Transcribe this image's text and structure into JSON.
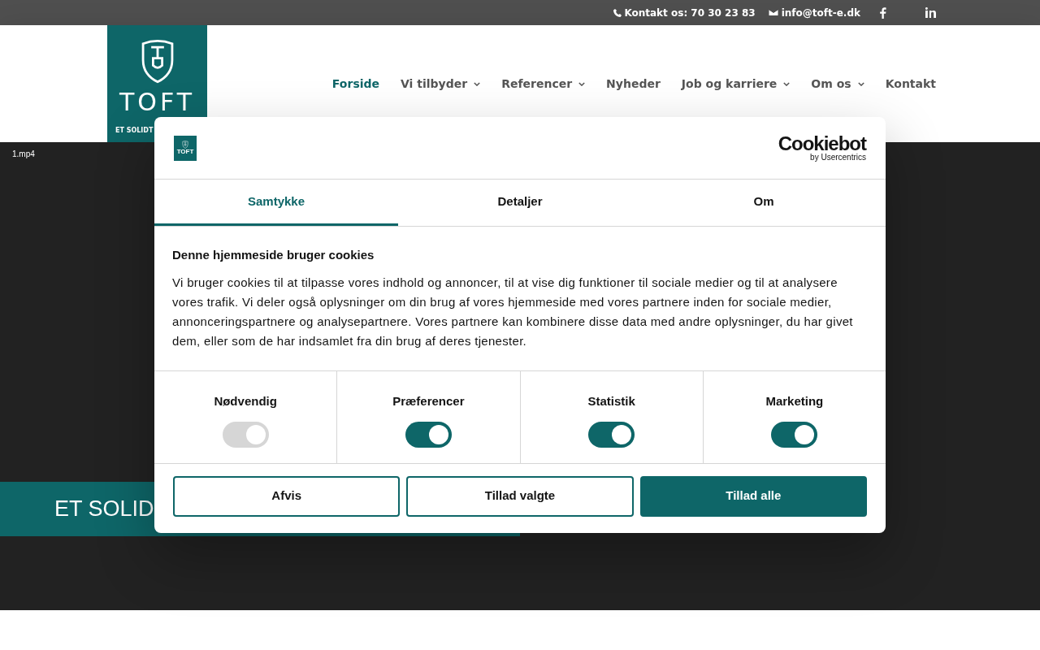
{
  "top_bar": {
    "phone": "Kontakt os: 70 30 23 83",
    "email": "info@toft-e.dk"
  },
  "header": {
    "logo": {
      "name": "TOFT",
      "tagline": "ET SOLIDT"
    },
    "nav": [
      {
        "label": "Forside",
        "selected": true,
        "dropdown": false
      },
      {
        "label": "Vi tilbyder",
        "selected": false,
        "dropdown": true
      },
      {
        "label": "Referencer",
        "selected": false,
        "dropdown": true
      },
      {
        "label": "Nyheder",
        "selected": false,
        "dropdown": false
      },
      {
        "label": "Job og karriere",
        "selected": false,
        "dropdown": true
      },
      {
        "label": "Om os",
        "selected": false,
        "dropdown": true
      },
      {
        "label": "Kontakt",
        "selected": false,
        "dropdown": false
      }
    ]
  },
  "hero": {
    "video_label": "1.mp4",
    "banner": "ET SOLID"
  },
  "cookie_dialog": {
    "logo_text": "TOFT",
    "brand": "Cookiebot",
    "brand_sub": "by Usercentrics",
    "tabs": [
      {
        "label": "Samtykke",
        "selected": true
      },
      {
        "label": "Detaljer",
        "selected": false
      },
      {
        "label": "Om",
        "selected": false
      }
    ],
    "heading": "Denne hjemmeside bruger cookies",
    "body": "Vi bruger cookies til at tilpasse vores indhold og annoncer, til at vise dig funktioner til sociale medier og til at analysere vores trafik. Vi deler også oplysninger om din brug af vores hjemmeside med vores partnere inden for sociale medier, annonceringspartnere og analysepartnere. Vores partnere kan kombinere disse data med andre oplysninger, du har givet dem, eller som de har indsamlet fra din brug af deres tjenester.",
    "toggles": [
      {
        "label": "Nødvendig",
        "on": true,
        "disabled": true
      },
      {
        "label": "Præferencer",
        "on": true,
        "disabled": false
      },
      {
        "label": "Statistik",
        "on": true,
        "disabled": false
      },
      {
        "label": "Marketing",
        "on": true,
        "disabled": false
      }
    ],
    "buttons": [
      {
        "label": "Afvis",
        "kind": "outline"
      },
      {
        "label": "Tillad valgte",
        "kind": "outline"
      },
      {
        "label": "Tillad alle",
        "kind": "filled"
      }
    ]
  }
}
